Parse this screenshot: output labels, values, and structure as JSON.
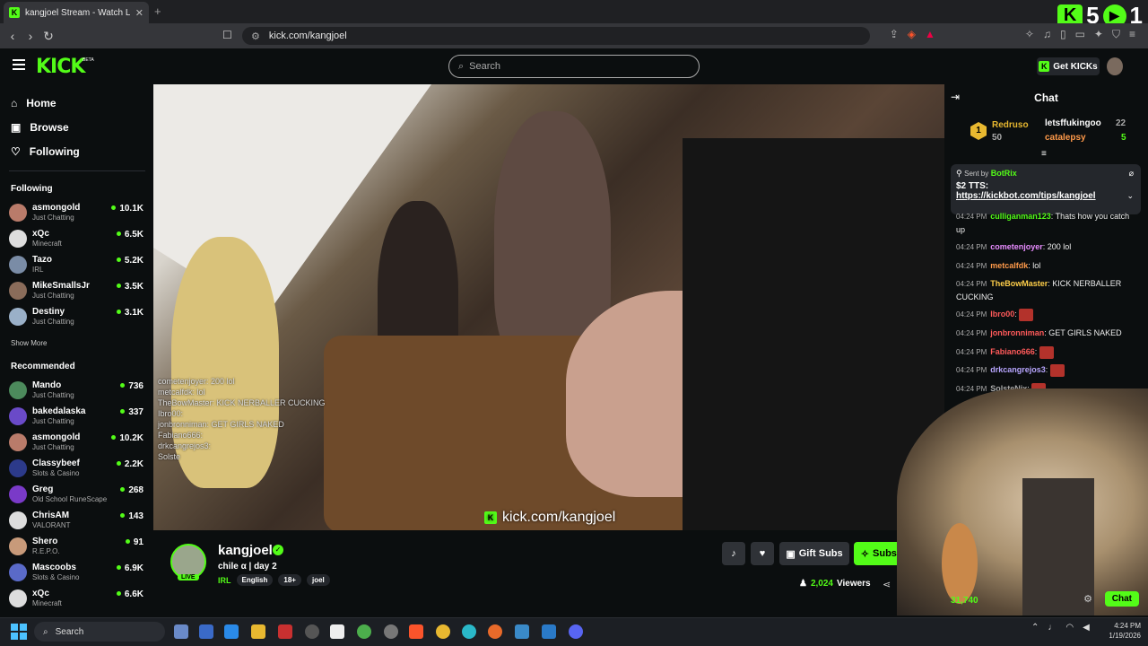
{
  "browser": {
    "tab_title": "kangjoel Stream - Watch Live",
    "url": "kick.com/kangjoel"
  },
  "overlay": {
    "kick_count": "5",
    "play_count": "1"
  },
  "site": {
    "logo": "KICK",
    "beta": "BETA",
    "search_placeholder": "Search",
    "get_kicks": "Get KICKs"
  },
  "nav": {
    "home": "Home",
    "browse": "Browse",
    "following": "Following"
  },
  "following_heading": "Following",
  "following": [
    {
      "name": "asmongold",
      "cat": "Just Chatting",
      "viewers": "10.1K",
      "color": "#b97b6a"
    },
    {
      "name": "xQc",
      "cat": "Minecraft",
      "viewers": "6.5K",
      "color": "#ddd"
    },
    {
      "name": "Tazo",
      "cat": "IRL",
      "viewers": "5.2K",
      "color": "#7a8ca6"
    },
    {
      "name": "MikeSmallsJr",
      "cat": "Just Chatting",
      "viewers": "3.5K",
      "color": "#8a6c5a"
    },
    {
      "name": "Destiny",
      "cat": "Just Chatting",
      "viewers": "3.1K",
      "color": "#9ab0c8"
    }
  ],
  "show_more": "Show More",
  "recommended_heading": "Recommended",
  "recommended": [
    {
      "name": "Mando",
      "cat": "Just Chatting",
      "viewers": "736",
      "color": "#4c8a5c"
    },
    {
      "name": "bakedalaska",
      "cat": "Just Chatting",
      "viewers": "337",
      "color": "#6a4ac8"
    },
    {
      "name": "asmongold",
      "cat": "Just Chatting",
      "viewers": "10.2K",
      "color": "#b97b6a"
    },
    {
      "name": "Classybeef",
      "cat": "Slots & Casino",
      "viewers": "2.2K",
      "color": "#2c3a8a"
    },
    {
      "name": "Greg",
      "cat": "Old School RuneScape",
      "viewers": "268",
      "color": "#7a3ac8"
    },
    {
      "name": "ChrisAM",
      "cat": "VALORANT",
      "viewers": "143",
      "color": "#ddd"
    },
    {
      "name": "Shero",
      "cat": "R.E.P.O.",
      "viewers": "91",
      "color": "#c89a7a"
    },
    {
      "name": "Mascoobs",
      "cat": "Slots & Casino",
      "viewers": "6.9K",
      "color": "#5a6ac8"
    },
    {
      "name": "xQc",
      "cat": "Minecraft",
      "viewers": "6.6K",
      "color": "#ddd"
    }
  ],
  "video": {
    "watermark": "kick.com/kangjoel",
    "overlay_chat": [
      "cometenjoyer: 200 lol",
      "metcalfdk: lol",
      "TheBowMaster: KICK NERBALLER CUCKING",
      "Ibro00:",
      "jonbronniman: GET GIRLS NAKED",
      "Fabiano666:",
      "drkcangrejos3:",
      "Solste"
    ]
  },
  "channel": {
    "name": "kangjoel",
    "live": "LIVE",
    "title": "chile α | day 2",
    "category": "IRL",
    "tags": [
      "English",
      "18+",
      "joel"
    ],
    "viewers": "2,024",
    "viewers_label": "Viewers"
  },
  "actions": {
    "gift": "Gift Subs",
    "subscribe": "Subscribe"
  },
  "chat": {
    "title": "Chat",
    "leaderboard": [
      {
        "name": "Redruso",
        "pts": "50"
      },
      {
        "name": "letsffukingoo",
        "pts": "22"
      },
      {
        "name": "catalepsy",
        "pts": "5"
      }
    ],
    "pinned": {
      "sent_by": "Sent by",
      "bot": "BotRix",
      "amount": "$2 TTS:",
      "link": "https://kickbot.com/tips/kangjoel"
    },
    "messages": [
      {
        "ts": "04:24 PM",
        "user": "culliganman123",
        "text": ": Thats how you catch up",
        "color": "#53fc18"
      },
      {
        "ts": "04:24 PM",
        "user": "cometenjoyer",
        "text": ": 200 lol",
        "color": "#e88cff"
      },
      {
        "ts": "04:24 PM",
        "user": "metcalfdk",
        "text": ": lol",
        "color": "#ff9a4a"
      },
      {
        "ts": "04:24 PM",
        "user": "TheBowMaster",
        "text": ": KICK NERBALLER CUCKING",
        "color": "#ffcf4a"
      },
      {
        "ts": "04:24 PM",
        "user": "Ibro00",
        "text": ":",
        "color": "#ff5a5a"
      },
      {
        "ts": "04:24 PM",
        "user": "jonbronniman",
        "text": ": GET GIRLS NAKED",
        "color": "#ff5a5a"
      },
      {
        "ts": "04:24 PM",
        "user": "Fabiano666",
        "text": ":",
        "color": "#ff5a5a"
      },
      {
        "ts": "04:24 PM",
        "user": "drkcangrejos3",
        "text": ":",
        "color": "#b8a6ff"
      },
      {
        "ts": "04:24 PM",
        "user": "SolsteNix",
        "text": ":",
        "color": "#aaa"
      }
    ],
    "points": "31,740",
    "button": "Chat"
  },
  "taskbar": {
    "search": "Search",
    "time": "4:24 PM",
    "date": "1/19/2026"
  }
}
